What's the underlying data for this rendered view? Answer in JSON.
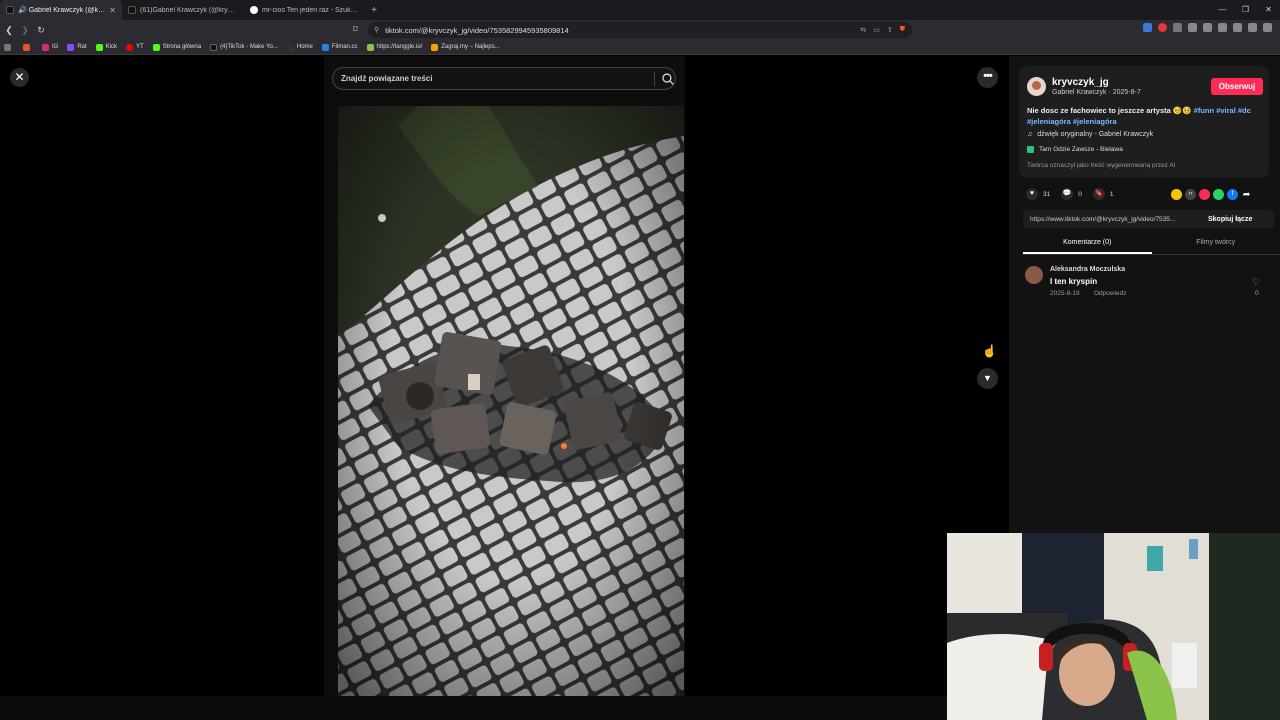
{
  "browser": {
    "tabs": [
      {
        "title": "Gabriel Krawczyk (@kryvczyk_jg)",
        "active": true
      },
      {
        "title": "(61)Gabriel Krawczyk (@kryvczyk_jg)",
        "active": false
      },
      {
        "title": "mr-cios Ten jeden raz - Szukaj w Google",
        "active": false
      }
    ],
    "new_tab": "+",
    "url": "tiktok.com/@kryvczyk_jg/video/7535829945935809814",
    "bookmarks": [
      {
        "label": "",
        "color": "#e8542a"
      },
      {
        "label": "IG",
        "color": "#d62976"
      },
      {
        "label": "Rat",
        "color": "#8a4dff"
      },
      {
        "label": "Kick",
        "color": "#53fc18"
      },
      {
        "label": "YT",
        "color": "#ff0000"
      },
      {
        "label": "Strona główna",
        "color": "#53fc18"
      },
      {
        "label": "(4)TikTok - Make Yo...",
        "color": "#111111"
      },
      {
        "label": "Home",
        "color": "#333333"
      },
      {
        "label": "Filman.cc",
        "color": "#1e88e5"
      },
      {
        "label": "https://tanggle.io/",
        "color": "#8bc34a"
      },
      {
        "label": "Zagraj.my – Najleps...",
        "color": "#f4a300"
      }
    ]
  },
  "search": {
    "placeholder": "Znajdź powiązane treści"
  },
  "author": {
    "username": "kryvczyk_jg",
    "display_name": "Gabriel Krawczyk",
    "date": "2025-8-7",
    "follow_label": "Obserwuj"
  },
  "video": {
    "description_text": "Nie dosc ze fachowiec to jeszcze artysta 🥺🥺",
    "hashtags": [
      "#funn",
      "#viral",
      "#dc",
      "#jeleniagóra",
      "#jeleniagóra"
    ],
    "music": "dźwięk oryginalny - Gabriel Krawczyk",
    "location": "Tam Gdzie Zawsze - Bielawa",
    "ai_note": "Twórca oznaczył jako treść wygenerowaną przez AI",
    "likes": "31",
    "comments": "0",
    "saves": "1",
    "link": "https://www.tiktok.com/@kryvczyk_jg/video/7535...",
    "copy_label": "Skopiuj łącze"
  },
  "panel_tabs": {
    "comments": "Komentarze (0)",
    "creator_videos": "Filmy twórcy"
  },
  "comments": [
    {
      "author": "Aleksandra Moczulska",
      "text": "I ten kryspin",
      "date": "2025-8-19",
      "reply": "Odpowiedz",
      "likes": "0"
    }
  ],
  "colors": {
    "accent": "#fe2c55",
    "hashtag": "#7ab8ff",
    "background": "#000000",
    "panel": "#121212"
  }
}
